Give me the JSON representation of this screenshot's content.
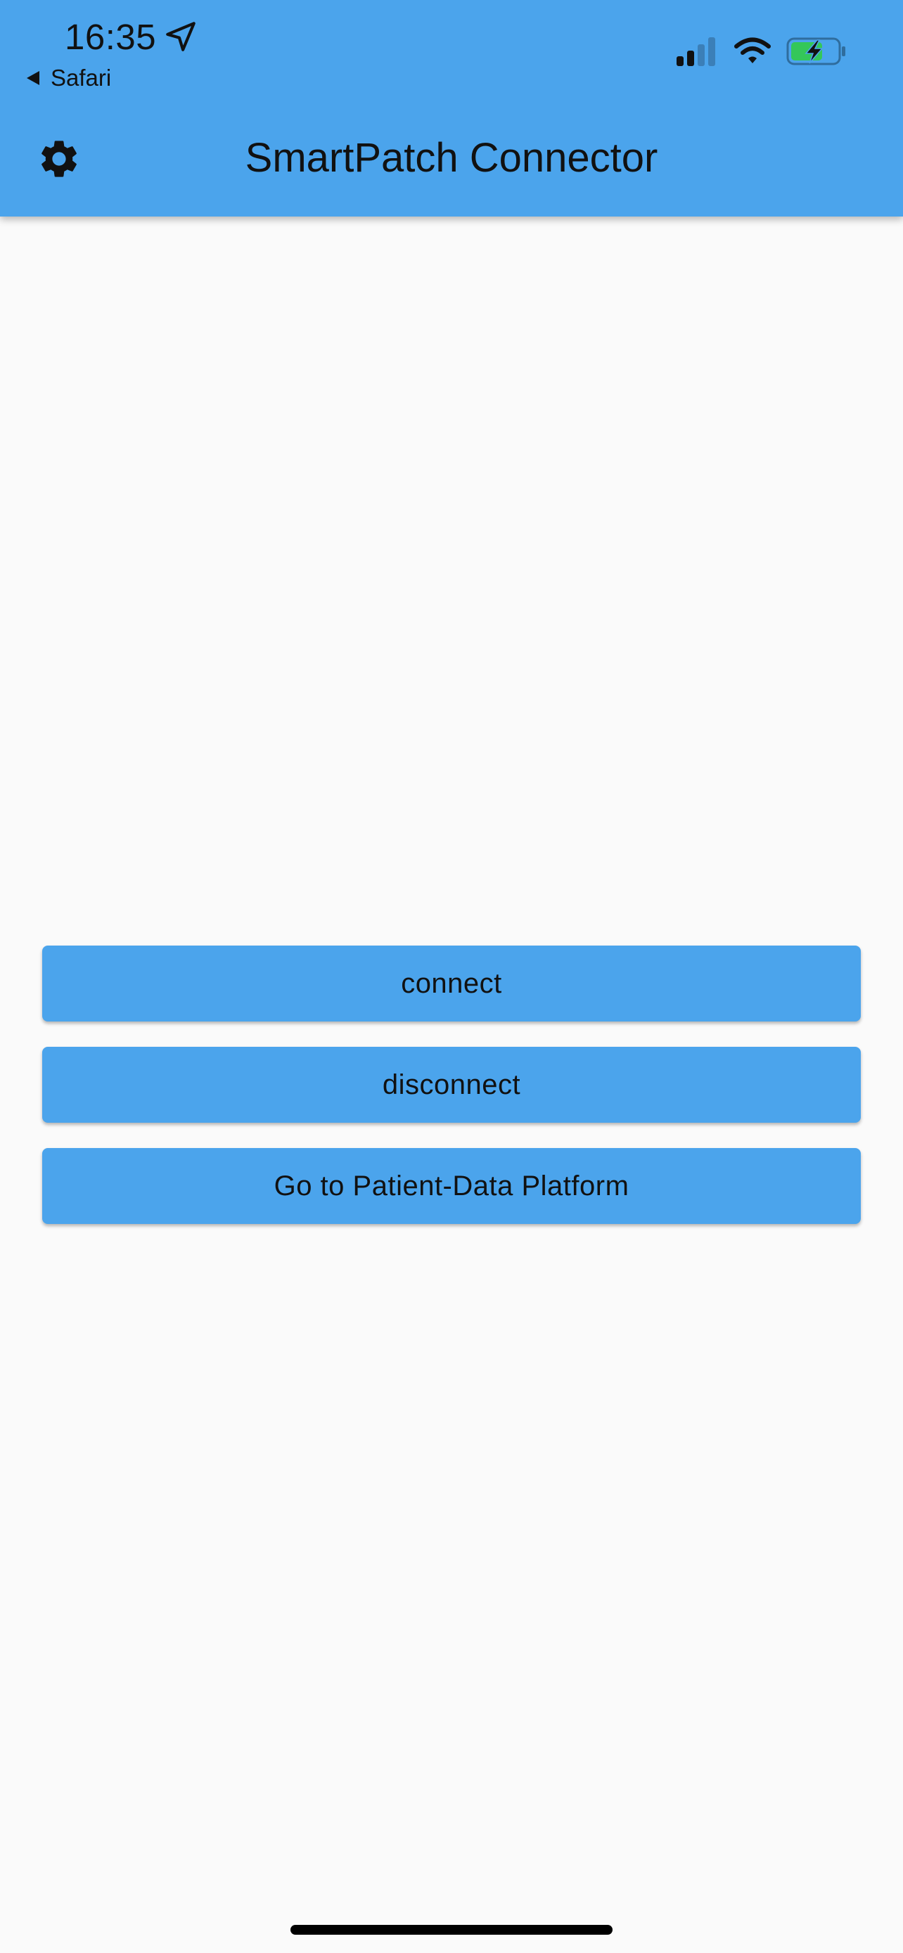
{
  "status_bar": {
    "time": "16:35",
    "back_label": "Safari",
    "icons": [
      "location-arrow-icon",
      "cellular-signal-icon",
      "wifi-icon",
      "battery-charging-icon"
    ]
  },
  "app_bar": {
    "title": "SmartPatch Connector",
    "leading_icon": "gear-icon",
    "color": "#4ba4ec"
  },
  "actions": [
    {
      "label": "connect"
    },
    {
      "label": "disconnect"
    },
    {
      "label": "Go to Patient-Data Platform"
    }
  ],
  "colors": {
    "primary": "#4ba4ec",
    "background": "#fafafa",
    "battery_fill": "#34c759"
  }
}
